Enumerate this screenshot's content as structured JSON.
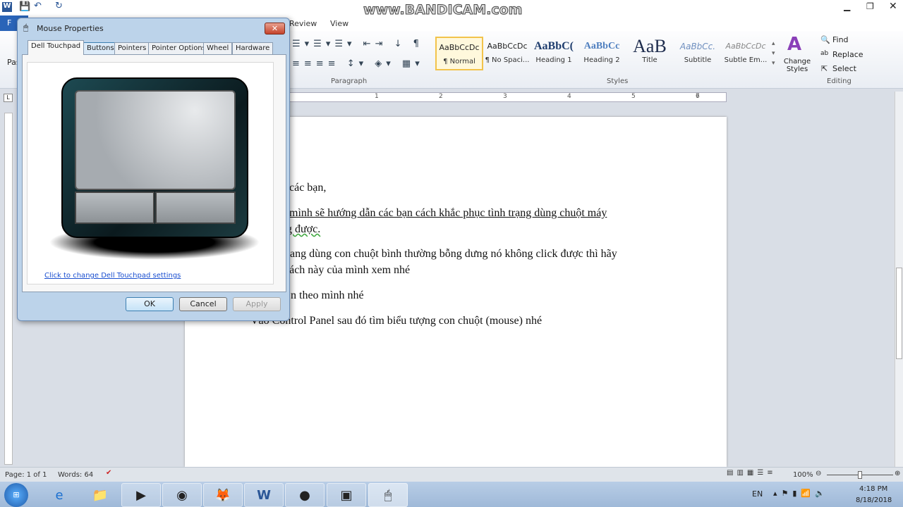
{
  "watermark": "www.BANDICAM.com",
  "ribbon": {
    "file_tab": "F",
    "tabs": [
      "Review",
      "View"
    ],
    "paste_label": "Pas",
    "paragraph_group": "Paragraph",
    "styles_group": "Styles",
    "editing_group": "Editing",
    "styles": [
      {
        "preview": "AaBbCcDc",
        "name": "¶ Normal"
      },
      {
        "preview": "AaBbCcDc",
        "name": "¶ No Spaci..."
      },
      {
        "preview": "AaBbC(",
        "name": "Heading 1"
      },
      {
        "preview": "AaBbCc",
        "name": "Heading 2"
      },
      {
        "preview": "AaB",
        "name": "Title"
      },
      {
        "preview": "AaBbCc.",
        "name": "Subtitle"
      },
      {
        "preview": "AaBbCcDc",
        "name": "Subtle Em..."
      }
    ],
    "change_styles": "Change Styles",
    "find": "Find",
    "replace": "Replace",
    "select": "Select"
  },
  "ruler": [
    "1",
    "2",
    "3",
    "4",
    "5",
    "6",
    "7"
  ],
  "document": {
    "lines": [
      "o các bạn,",
      "y mình sẽ hướng dẫn các bạn cách khắc phục tình trạng dùng chuột máy",
      "ng được.",
      "đang dùng con chuột bình thường bỗng dưng nó không click được thì hãy",
      "cách này của mình xem nhé",
      "n theo mình nhé",
      "Vào Control Panel sau đó tìm biểu tượng con chuột (mouse) nhé"
    ]
  },
  "dialog": {
    "title": "Mouse Properties",
    "tabs": [
      "Dell Touchpad",
      "Buttons",
      "Pointers",
      "Pointer Options",
      "Wheel",
      "Hardware"
    ],
    "link": "Click to change Dell Touchpad settings",
    "ok": "OK",
    "cancel": "Cancel",
    "apply": "Apply"
  },
  "status": {
    "page": "Page: 1 of 1",
    "words": "Words: 64",
    "zoom": "100%",
    "zoom_percent": 100
  },
  "taskbar": {
    "lang": "EN",
    "time": "4:18 PM",
    "date": "8/18/2018"
  }
}
